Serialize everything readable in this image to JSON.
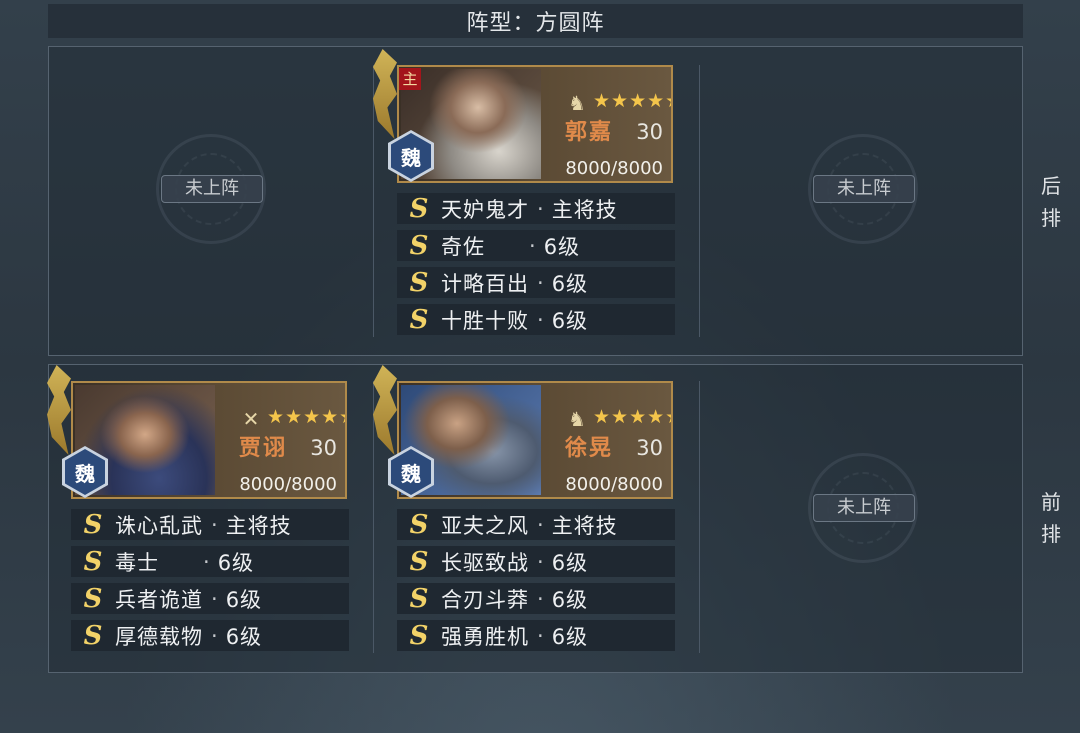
{
  "formation": {
    "title": "阵型：方圆阵"
  },
  "rows": {
    "back": {
      "label_1": "后",
      "label_2": "排"
    },
    "front": {
      "label_1": "前",
      "label_2": "排"
    }
  },
  "empty_slot_label": "未上阵",
  "colors": {
    "star": "#f4c54b",
    "name": "#e08a4a",
    "grade": "#f2d268",
    "kingdom": "#2c4a7a",
    "lord_badge": "#a3151b"
  },
  "generals": {
    "guojia": {
      "name": "郭嘉",
      "level": "30",
      "stars": "★★★★★",
      "kingdom": "魏",
      "lord_badge": "主",
      "unit_type_icon": "cavalry-icon",
      "hp_text": "8000/8000",
      "hp_fraction": 1.0,
      "skills": [
        {
          "grade": "S",
          "name": "天妒鬼才",
          "sep": "·",
          "level": "主将技"
        },
        {
          "grade": "S",
          "name": "奇佐",
          "sep": "·",
          "level": "6级"
        },
        {
          "grade": "S",
          "name": "计略百出",
          "sep": "·",
          "level": "6级"
        },
        {
          "grade": "S",
          "name": "十胜十败",
          "sep": "·",
          "level": "6级"
        }
      ]
    },
    "jiaxu": {
      "name": "贾诩",
      "level": "30",
      "stars": "★★★★★",
      "kingdom": "魏",
      "unit_type_icon": "pike-icon",
      "hp_text": "8000/8000",
      "hp_fraction": 1.0,
      "skills": [
        {
          "grade": "S",
          "name": "诛心乱武",
          "sep": "·",
          "level": "主将技"
        },
        {
          "grade": "S",
          "name": "毒士",
          "sep": "·",
          "level": "6级"
        },
        {
          "grade": "S",
          "name": "兵者诡道",
          "sep": "·",
          "level": "6级"
        },
        {
          "grade": "S",
          "name": "厚德载物",
          "sep": "·",
          "level": "6级"
        }
      ]
    },
    "xuhuang": {
      "name": "徐晃",
      "level": "30",
      "stars": "★★★★★",
      "kingdom": "魏",
      "unit_type_icon": "cavalry-icon",
      "hp_text": "8000/8000",
      "hp_fraction": 1.0,
      "skills": [
        {
          "grade": "S",
          "name": "亚夫之风",
          "sep": "·",
          "level": "主将技"
        },
        {
          "grade": "S",
          "name": "长驱致战",
          "sep": "·",
          "level": "6级"
        },
        {
          "grade": "S",
          "name": "合刃斗莽",
          "sep": "·",
          "level": "6级"
        },
        {
          "grade": "S",
          "name": "强勇胜机",
          "sep": "·",
          "level": "6级"
        }
      ]
    }
  }
}
